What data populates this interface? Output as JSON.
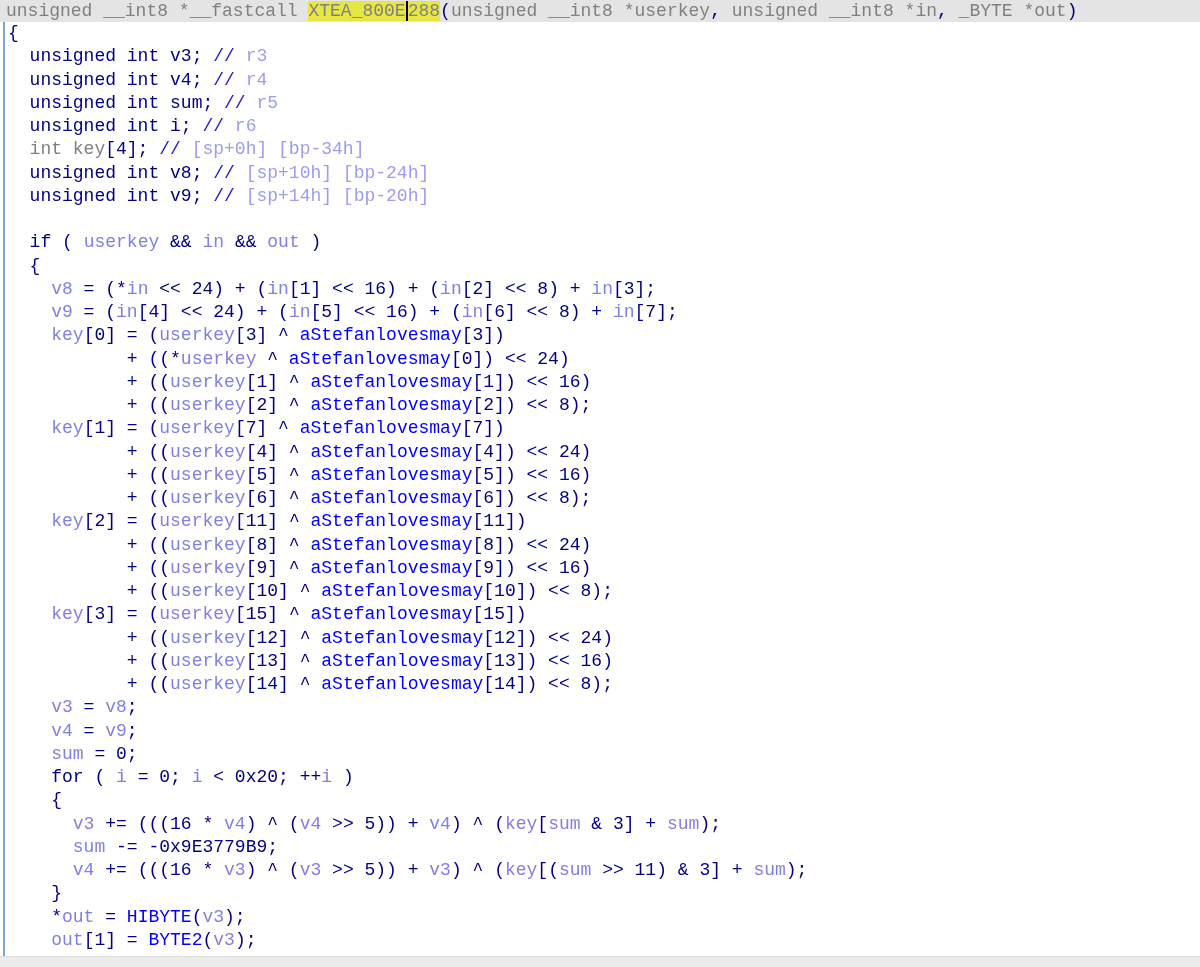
{
  "signature": [
    {
      "kind": "dim",
      "text": "unsigned __int8 *__fastcall "
    },
    {
      "kind": "name",
      "text": "XTEA_800E",
      "caret_after": true
    },
    {
      "kind": "name",
      "text": "288",
      "caret_after": false
    },
    {
      "kind": "code",
      "text": "("
    },
    {
      "kind": "dim",
      "text": "unsigned __int8 *userkey"
    },
    {
      "kind": "code",
      "text": ", "
    },
    {
      "kind": "dim",
      "text": "unsigned __int8 *in"
    },
    {
      "kind": "code",
      "text": ", "
    },
    {
      "kind": "dim",
      "text": "_BYTE *out"
    },
    {
      "kind": "code",
      "text": ")"
    }
  ],
  "declarations": [
    [
      {
        "kind": "code",
        "text": "{"
      }
    ],
    [
      {
        "kind": "code",
        "text": "  unsigned int v3; "
      },
      {
        "kind": "slash",
        "text": "// "
      },
      {
        "kind": "comment",
        "text": "r3"
      }
    ],
    [
      {
        "kind": "code",
        "text": "  unsigned int v4; "
      },
      {
        "kind": "slash",
        "text": "// "
      },
      {
        "kind": "comment",
        "text": "r4"
      }
    ],
    [
      {
        "kind": "code",
        "text": "  unsigned int sum; "
      },
      {
        "kind": "slash",
        "text": "// "
      },
      {
        "kind": "comment",
        "text": "r5"
      }
    ],
    [
      {
        "kind": "code",
        "text": "  unsigned int i; "
      },
      {
        "kind": "slash",
        "text": "// "
      },
      {
        "kind": "comment",
        "text": "r6"
      }
    ],
    [
      {
        "kind": "dim",
        "text": "  int key"
      },
      {
        "kind": "code",
        "text": "[4]; "
      },
      {
        "kind": "slash",
        "text": "// "
      },
      {
        "kind": "comment",
        "text": "[sp+0h] [bp-34h]"
      }
    ],
    [
      {
        "kind": "code",
        "text": "  unsigned int v8; "
      },
      {
        "kind": "slash",
        "text": "// "
      },
      {
        "kind": "comment",
        "text": "[sp+10h] [bp-24h]"
      }
    ],
    [
      {
        "kind": "code",
        "text": "  unsigned int v9; "
      },
      {
        "kind": "slash",
        "text": "// "
      },
      {
        "kind": "comment",
        "text": "[sp+14h] [bp-20h]"
      }
    ]
  ],
  "body": [
    [
      {
        "kind": "code",
        "text": "  if ( "
      },
      {
        "kind": "var",
        "text": "userkey"
      },
      {
        "kind": "code",
        "text": " && "
      },
      {
        "kind": "var",
        "text": "in"
      },
      {
        "kind": "code",
        "text": " && "
      },
      {
        "kind": "var",
        "text": "out"
      },
      {
        "kind": "code",
        "text": " )"
      }
    ],
    [
      {
        "kind": "code",
        "text": "  {"
      }
    ],
    [
      {
        "kind": "var",
        "text": "    v8"
      },
      {
        "kind": "code",
        "text": " = (*"
      },
      {
        "kind": "var",
        "text": "in"
      },
      {
        "kind": "code",
        "text": " << 24) + ("
      },
      {
        "kind": "var",
        "text": "in"
      },
      {
        "kind": "code",
        "text": "[1] << 16) + ("
      },
      {
        "kind": "var",
        "text": "in"
      },
      {
        "kind": "code",
        "text": "[2] << 8) + "
      },
      {
        "kind": "var",
        "text": "in"
      },
      {
        "kind": "code",
        "text": "[3];"
      }
    ],
    [
      {
        "kind": "var",
        "text": "    v9"
      },
      {
        "kind": "code",
        "text": " = ("
      },
      {
        "kind": "var",
        "text": "in"
      },
      {
        "kind": "code",
        "text": "[4] << 24) + ("
      },
      {
        "kind": "var",
        "text": "in"
      },
      {
        "kind": "code",
        "text": "[5] << 16) + ("
      },
      {
        "kind": "var",
        "text": "in"
      },
      {
        "kind": "code",
        "text": "[6] << 8) + "
      },
      {
        "kind": "var",
        "text": "in"
      },
      {
        "kind": "code",
        "text": "[7];"
      }
    ],
    [
      {
        "kind": "var",
        "text": "    key"
      },
      {
        "kind": "code",
        "text": "[0] = ("
      },
      {
        "kind": "var",
        "text": "userkey"
      },
      {
        "kind": "code",
        "text": "[3] ^ "
      },
      {
        "kind": "global",
        "text": "aStefanlovesmay"
      },
      {
        "kind": "code",
        "text": "[3])"
      }
    ],
    [
      {
        "kind": "code",
        "text": "           + ((*"
      },
      {
        "kind": "var",
        "text": "userkey"
      },
      {
        "kind": "code",
        "text": " ^ "
      },
      {
        "kind": "global",
        "text": "aStefanlovesmay"
      },
      {
        "kind": "code",
        "text": "[0]) << 24)"
      }
    ],
    [
      {
        "kind": "code",
        "text": "           + (("
      },
      {
        "kind": "var",
        "text": "userkey"
      },
      {
        "kind": "code",
        "text": "[1] ^ "
      },
      {
        "kind": "global",
        "text": "aStefanlovesmay"
      },
      {
        "kind": "code",
        "text": "[1]) << 16)"
      }
    ],
    [
      {
        "kind": "code",
        "text": "           + (("
      },
      {
        "kind": "var",
        "text": "userkey"
      },
      {
        "kind": "code",
        "text": "[2] ^ "
      },
      {
        "kind": "global",
        "text": "aStefanlovesmay"
      },
      {
        "kind": "code",
        "text": "[2]) << 8);"
      }
    ],
    [
      {
        "kind": "var",
        "text": "    key"
      },
      {
        "kind": "code",
        "text": "[1] = ("
      },
      {
        "kind": "var",
        "text": "userkey"
      },
      {
        "kind": "code",
        "text": "[7] ^ "
      },
      {
        "kind": "global",
        "text": "aStefanlovesmay"
      },
      {
        "kind": "code",
        "text": "[7])"
      }
    ],
    [
      {
        "kind": "code",
        "text": "           + (("
      },
      {
        "kind": "var",
        "text": "userkey"
      },
      {
        "kind": "code",
        "text": "[4] ^ "
      },
      {
        "kind": "global",
        "text": "aStefanlovesmay"
      },
      {
        "kind": "code",
        "text": "[4]) << 24)"
      }
    ],
    [
      {
        "kind": "code",
        "text": "           + (("
      },
      {
        "kind": "var",
        "text": "userkey"
      },
      {
        "kind": "code",
        "text": "[5] ^ "
      },
      {
        "kind": "global",
        "text": "aStefanlovesmay"
      },
      {
        "kind": "code",
        "text": "[5]) << 16)"
      }
    ],
    [
      {
        "kind": "code",
        "text": "           + (("
      },
      {
        "kind": "var",
        "text": "userkey"
      },
      {
        "kind": "code",
        "text": "[6] ^ "
      },
      {
        "kind": "global",
        "text": "aStefanlovesmay"
      },
      {
        "kind": "code",
        "text": "[6]) << 8);"
      }
    ],
    [
      {
        "kind": "var",
        "text": "    key"
      },
      {
        "kind": "code",
        "text": "[2] = ("
      },
      {
        "kind": "var",
        "text": "userkey"
      },
      {
        "kind": "code",
        "text": "[11] ^ "
      },
      {
        "kind": "global",
        "text": "aStefanlovesmay"
      },
      {
        "kind": "code",
        "text": "[11])"
      }
    ],
    [
      {
        "kind": "code",
        "text": "           + (("
      },
      {
        "kind": "var",
        "text": "userkey"
      },
      {
        "kind": "code",
        "text": "[8] ^ "
      },
      {
        "kind": "global",
        "text": "aStefanlovesmay"
      },
      {
        "kind": "code",
        "text": "[8]) << 24)"
      }
    ],
    [
      {
        "kind": "code",
        "text": "           + (("
      },
      {
        "kind": "var",
        "text": "userkey"
      },
      {
        "kind": "code",
        "text": "[9] ^ "
      },
      {
        "kind": "global",
        "text": "aStefanlovesmay"
      },
      {
        "kind": "code",
        "text": "[9]) << 16)"
      }
    ],
    [
      {
        "kind": "code",
        "text": "           + (("
      },
      {
        "kind": "var",
        "text": "userkey"
      },
      {
        "kind": "code",
        "text": "[10] ^ "
      },
      {
        "kind": "global",
        "text": "aStefanlovesmay"
      },
      {
        "kind": "code",
        "text": "[10]) << 8);"
      }
    ],
    [
      {
        "kind": "var",
        "text": "    key"
      },
      {
        "kind": "code",
        "text": "[3] = ("
      },
      {
        "kind": "var",
        "text": "userkey"
      },
      {
        "kind": "code",
        "text": "[15] ^ "
      },
      {
        "kind": "global",
        "text": "aStefanlovesmay"
      },
      {
        "kind": "code",
        "text": "[15])"
      }
    ],
    [
      {
        "kind": "code",
        "text": "           + (("
      },
      {
        "kind": "var",
        "text": "userkey"
      },
      {
        "kind": "code",
        "text": "[12] ^ "
      },
      {
        "kind": "global",
        "text": "aStefanlovesmay"
      },
      {
        "kind": "code",
        "text": "[12]) << 24)"
      }
    ],
    [
      {
        "kind": "code",
        "text": "           + (("
      },
      {
        "kind": "var",
        "text": "userkey"
      },
      {
        "kind": "code",
        "text": "[13] ^ "
      },
      {
        "kind": "global",
        "text": "aStefanlovesmay"
      },
      {
        "kind": "code",
        "text": "[13]) << 16)"
      }
    ],
    [
      {
        "kind": "code",
        "text": "           + (("
      },
      {
        "kind": "var",
        "text": "userkey"
      },
      {
        "kind": "code",
        "text": "[14] ^ "
      },
      {
        "kind": "global",
        "text": "aStefanlovesmay"
      },
      {
        "kind": "code",
        "text": "[14]) << 8);"
      }
    ],
    [
      {
        "kind": "var",
        "text": "    v3"
      },
      {
        "kind": "code",
        "text": " = "
      },
      {
        "kind": "var",
        "text": "v8"
      },
      {
        "kind": "code",
        "text": ";"
      }
    ],
    [
      {
        "kind": "var",
        "text": "    v4"
      },
      {
        "kind": "code",
        "text": " = "
      },
      {
        "kind": "var",
        "text": "v9"
      },
      {
        "kind": "code",
        "text": ";"
      }
    ],
    [
      {
        "kind": "var",
        "text": "    sum"
      },
      {
        "kind": "code",
        "text": " = 0;"
      }
    ],
    [
      {
        "kind": "code",
        "text": "    for ( "
      },
      {
        "kind": "var",
        "text": "i"
      },
      {
        "kind": "code",
        "text": " = 0; "
      },
      {
        "kind": "var",
        "text": "i"
      },
      {
        "kind": "code",
        "text": " < 0x20; ++"
      },
      {
        "kind": "var",
        "text": "i"
      },
      {
        "kind": "code",
        "text": " )"
      }
    ],
    [
      {
        "kind": "code",
        "text": "    {"
      }
    ],
    [
      {
        "kind": "var",
        "text": "      v3"
      },
      {
        "kind": "code",
        "text": " += (((16 * "
      },
      {
        "kind": "var",
        "text": "v4"
      },
      {
        "kind": "code",
        "text": ") ^ ("
      },
      {
        "kind": "var",
        "text": "v4"
      },
      {
        "kind": "code",
        "text": " >> 5)) + "
      },
      {
        "kind": "var",
        "text": "v4"
      },
      {
        "kind": "code",
        "text": ") ^ ("
      },
      {
        "kind": "var",
        "text": "key"
      },
      {
        "kind": "code",
        "text": "["
      },
      {
        "kind": "var",
        "text": "sum"
      },
      {
        "kind": "code",
        "text": " & 3] + "
      },
      {
        "kind": "var",
        "text": "sum"
      },
      {
        "kind": "code",
        "text": ");"
      }
    ],
    [
      {
        "kind": "var",
        "text": "      sum"
      },
      {
        "kind": "code",
        "text": " -= -0x9E3779B9;"
      }
    ],
    [
      {
        "kind": "var",
        "text": "      v4"
      },
      {
        "kind": "code",
        "text": " += (((16 * "
      },
      {
        "kind": "var",
        "text": "v3"
      },
      {
        "kind": "code",
        "text": ") ^ ("
      },
      {
        "kind": "var",
        "text": "v3"
      },
      {
        "kind": "code",
        "text": " >> 5)) + "
      },
      {
        "kind": "var",
        "text": "v3"
      },
      {
        "kind": "code",
        "text": ") ^ ("
      },
      {
        "kind": "var",
        "text": "key"
      },
      {
        "kind": "code",
        "text": "[("
      },
      {
        "kind": "var",
        "text": "sum"
      },
      {
        "kind": "code",
        "text": " >> 11) & 3] + "
      },
      {
        "kind": "var",
        "text": "sum"
      },
      {
        "kind": "code",
        "text": ");"
      }
    ],
    [
      {
        "kind": "code",
        "text": "    }"
      }
    ],
    [
      {
        "kind": "code",
        "text": "    *"
      },
      {
        "kind": "var",
        "text": "out"
      },
      {
        "kind": "code",
        "text": " = "
      },
      {
        "kind": "global",
        "text": "HIBYTE"
      },
      {
        "kind": "code",
        "text": "("
      },
      {
        "kind": "var",
        "text": "v3"
      },
      {
        "kind": "code",
        "text": ");"
      }
    ],
    [
      {
        "kind": "var",
        "text": "    out"
      },
      {
        "kind": "code",
        "text": "[1] = "
      },
      {
        "kind": "global",
        "text": "BYTE2"
      },
      {
        "kind": "code",
        "text": "("
      },
      {
        "kind": "var",
        "text": "v3"
      },
      {
        "kind": "code",
        "text": ");"
      }
    ]
  ]
}
